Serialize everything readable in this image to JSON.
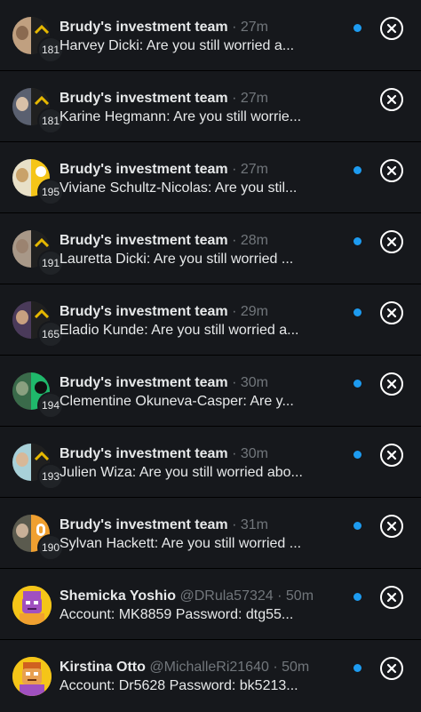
{
  "notifications": [
    {
      "title": "Brudy's investment team",
      "handle": "",
      "time": "· 27m",
      "count": "181",
      "preview": "Harvey Dicki: Are you still worried a...",
      "avatar_colors": [
        "#8a6a50",
        "#e6b800"
      ],
      "unread": true
    },
    {
      "title": "Brudy's investment team",
      "handle": "",
      "time": "· 27m",
      "count": "181",
      "preview": "Karine Hegmann: Are you still worrie...",
      "avatar_colors": [
        "#b0b7c3",
        "#e6b800"
      ],
      "unread": false
    },
    {
      "title": "Brudy's investment team",
      "handle": "",
      "time": "· 27m",
      "count": "195",
      "preview": "Viviane Schultz-Nicolas: Are you stil...",
      "avatar_colors": [
        "#c9a26a",
        "#f5c518"
      ],
      "unread": true
    },
    {
      "title": "Brudy's investment team",
      "handle": "",
      "time": "· 28m",
      "count": "191",
      "preview": "Lauretta Dicki: Are you still worried ...",
      "avatar_colors": [
        "#9b8370",
        "#e6b800"
      ],
      "unread": true
    },
    {
      "title": "Brudy's investment team",
      "handle": "",
      "time": "· 29m",
      "count": "165",
      "preview": "Eladio Kunde: Are you still worried a...",
      "avatar_colors": [
        "#6b4f7a",
        "#e6b800"
      ],
      "unread": true
    },
    {
      "title": "Brudy's investment team",
      "handle": "",
      "time": "· 30m",
      "count": "194",
      "preview": "Clementine Okuneva-Casper: Are y...",
      "avatar_colors": [
        "#4a7a4a",
        "#1fb86b"
      ],
      "unread": true
    },
    {
      "title": "Brudy's investment team",
      "handle": "",
      "time": "· 30m",
      "count": "193",
      "preview": "Julien Wiza: Are you still worried abo...",
      "avatar_colors": [
        "#7fb8c8",
        "#e6b800"
      ],
      "unread": true
    },
    {
      "title": "Brudy's investment team",
      "handle": "",
      "time": "· 31m",
      "count": "190",
      "preview": "Sylvan Hackett: Are you still worried ...",
      "avatar_colors": [
        "#6e6e5e",
        "#f0a030"
      ],
      "unread": true
    },
    {
      "title": "Shemicka Yoshio",
      "handle": "@DRula57324",
      "time": "· 50m",
      "count": "",
      "preview": "Account: MK8859 Password: dtg55...",
      "avatar_colors": [
        "#f5c518",
        "#a050c0"
      ],
      "unread": true
    },
    {
      "title": "Kirstina Otto",
      "handle": "@MichalleRi21640",
      "time": "· 50m",
      "count": "",
      "preview": "Account: Dr5628 Password: bk5213...",
      "avatar_colors": [
        "#f5c518",
        "#a050c0"
      ],
      "unread": true
    }
  ],
  "colors": {
    "background": "#16181c",
    "divider": "#000000",
    "unread_dot": "#1d9bf0",
    "muted_text": "#71767b",
    "primary_text": "#e7e9ea"
  },
  "icons": {
    "close": "close-circle-icon",
    "chevron": "chevron-up-icon"
  }
}
